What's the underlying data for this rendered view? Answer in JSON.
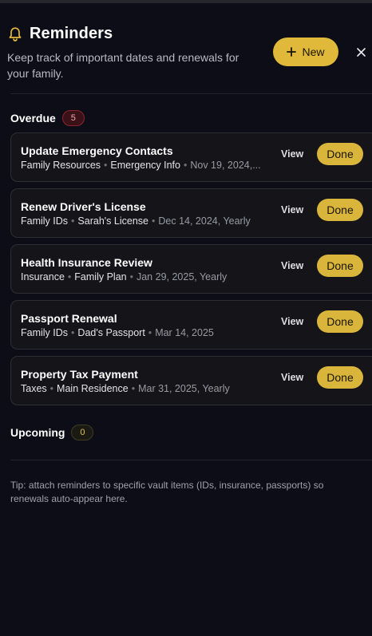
{
  "header": {
    "title": "Reminders",
    "subtitle": "Keep track of important dates and renewals for your family.",
    "new_button_label": "New",
    "bell_icon": "bell-icon",
    "close_icon": "close-icon"
  },
  "colors": {
    "background": "#0d0d18",
    "accent": "#e0b93a",
    "overdue_badge": "#8a2531"
  },
  "overdue": {
    "title": "Overdue",
    "count": "5",
    "items": [
      {
        "title": "Update Emergency Contacts",
        "category": "Family Resources",
        "item": "Emergency Info",
        "date": "Nov 19, 2024,...",
        "view_label": "View",
        "done_label": "Done"
      },
      {
        "title": "Renew Driver's License",
        "category": "Family IDs",
        "item": "Sarah's License",
        "date": "Dec 14, 2024, Yearly",
        "view_label": "View",
        "done_label": "Done"
      },
      {
        "title": "Health Insurance Review",
        "category": "Insurance",
        "item": "Family Plan",
        "date": "Jan 29, 2025, Yearly",
        "view_label": "View",
        "done_label": "Done"
      },
      {
        "title": "Passport Renewal",
        "category": "Family IDs",
        "item": "Dad's Passport",
        "date": "Mar 14, 2025",
        "view_label": "View",
        "done_label": "Done"
      },
      {
        "title": "Property Tax Payment",
        "category": "Taxes",
        "item": "Main Residence",
        "date": "Mar 31, 2025, Yearly",
        "view_label": "View",
        "done_label": "Done"
      }
    ]
  },
  "upcoming": {
    "title": "Upcoming",
    "count": "0"
  },
  "tip": "Tip: attach reminders to specific vault items (IDs, insurance, passports) so renewals auto-appear here."
}
